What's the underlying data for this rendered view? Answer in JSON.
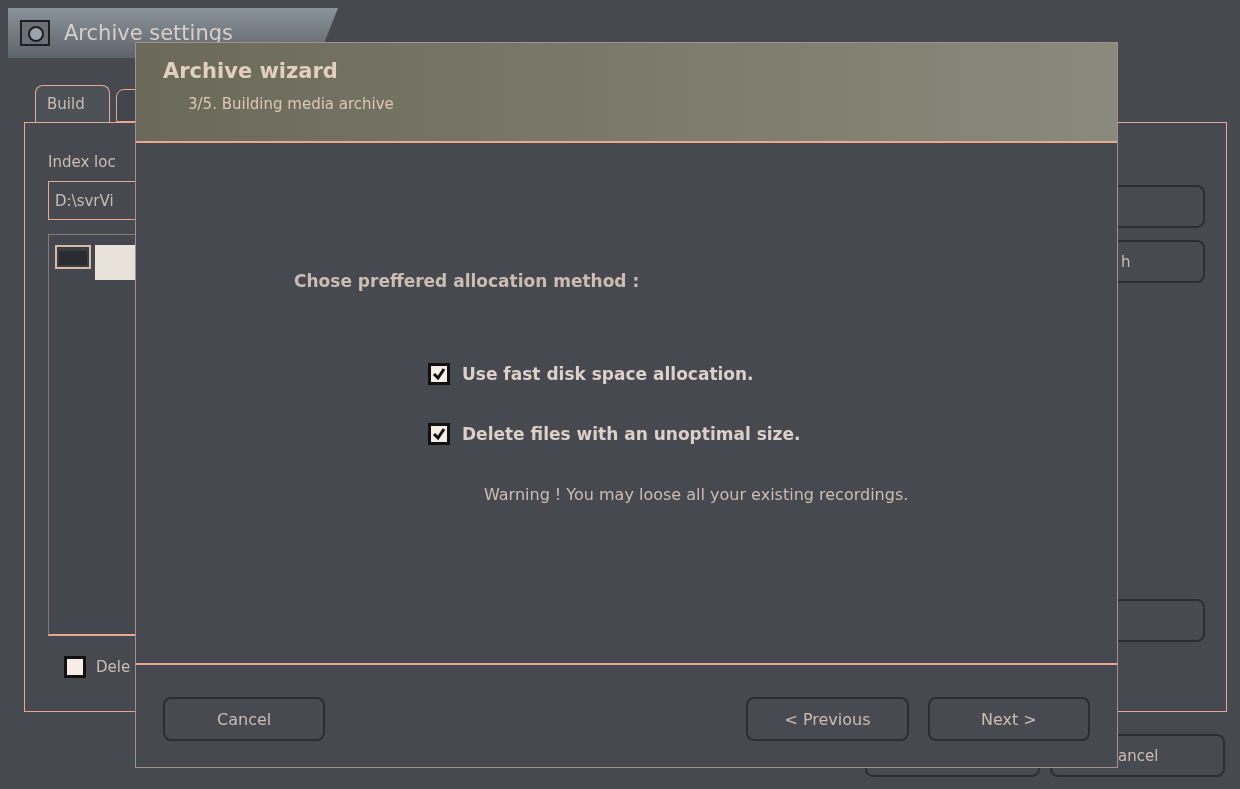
{
  "settings_window": {
    "title": "Archive settings",
    "tabs": [
      {
        "label": "Build",
        "selected": true
      },
      {
        "selected": false
      }
    ],
    "index_label": "Index loc",
    "index_path": "D:\\svrVi",
    "list_items": [
      {
        "selected": true
      }
    ],
    "side_buttons": [
      {
        "kind": "blank"
      },
      {
        "kind": "text",
        "label": "h"
      },
      {
        "kind": "blank"
      }
    ],
    "delete_option": {
      "label": "Dele",
      "checked": false
    },
    "bottom_buttons": [
      {
        "kind": "blank"
      },
      {
        "kind": "text",
        "label": "ancel"
      }
    ]
  },
  "wizard": {
    "title": "Archive wizard",
    "subtitle": "3/5. Building media archive",
    "prompt": "Chose preffered allocation method :",
    "options": [
      {
        "label": "Use fast disk space allocation.",
        "checked": true
      },
      {
        "label": "Delete files with an unoptimal size.",
        "checked": true
      }
    ],
    "warning": "Warning ! You may loose all your existing recordings.",
    "buttons": [
      {
        "kind": "left",
        "label": "Cancel"
      },
      {
        "kind": "right",
        "label": "< Previous"
      },
      {
        "kind": "right",
        "label": "Next >"
      }
    ]
  }
}
